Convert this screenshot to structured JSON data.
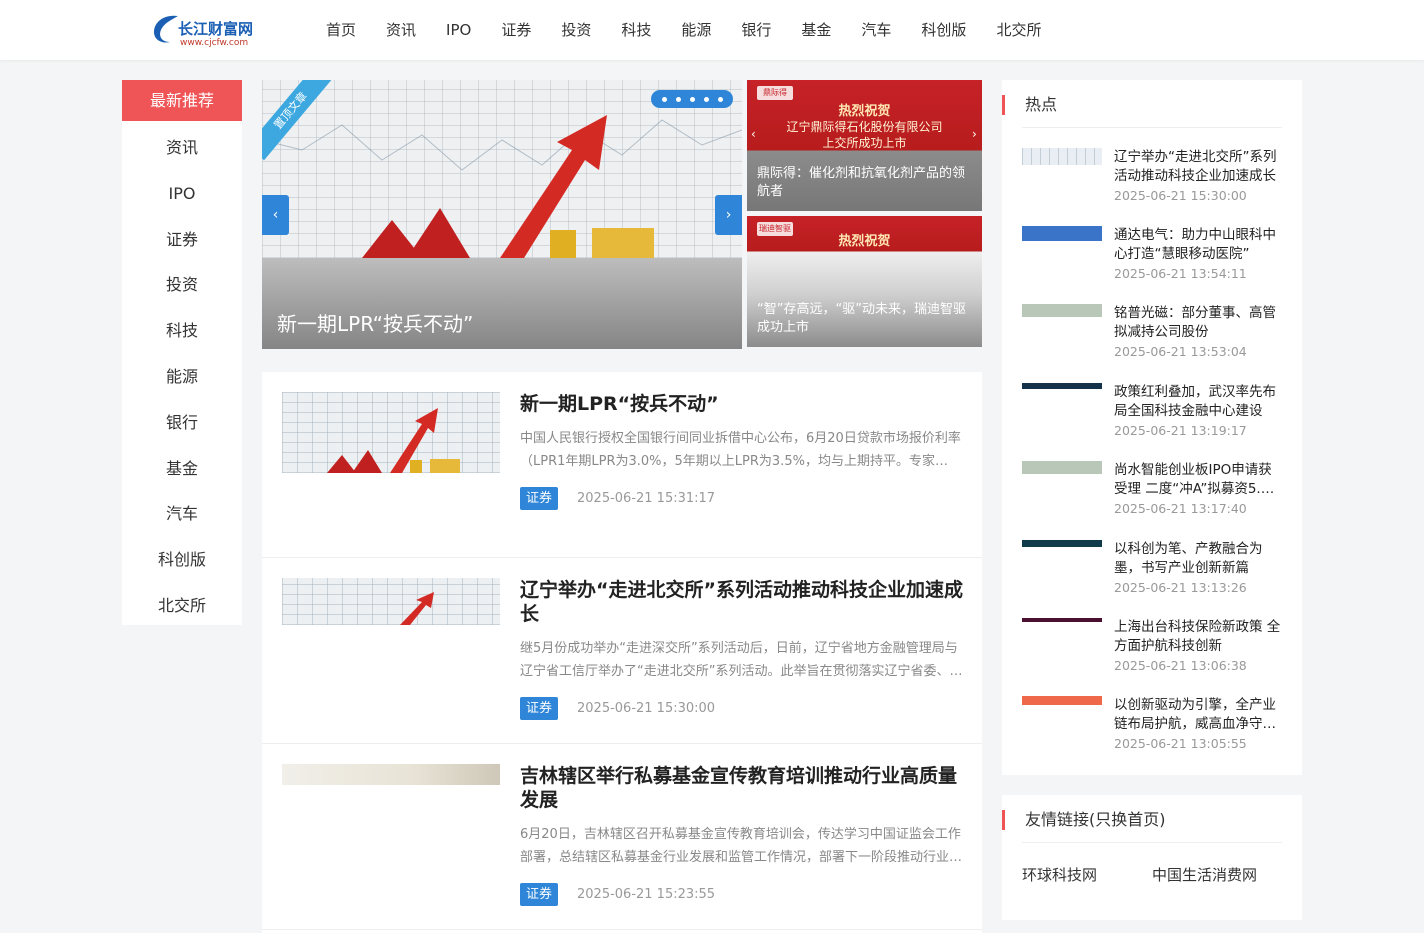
{
  "header": {
    "logo_name": "长江财富网",
    "logo_url": "www.cjcfw.com",
    "nav": [
      "首页",
      "资讯",
      "IPO",
      "证券",
      "投资",
      "科技",
      "能源",
      "银行",
      "基金",
      "汽车",
      "科创版",
      "北交所"
    ]
  },
  "sidebar": {
    "items": [
      "最新推荐",
      "资讯",
      "IPO",
      "证券",
      "投资",
      "科技",
      "能源",
      "银行",
      "基金",
      "汽车",
      "科创版",
      "北交所"
    ],
    "active_index": 0
  },
  "banner": {
    "ribbon": "置顶文章",
    "title": "新一期LPR“按兵不动”",
    "prev_icon": "‹",
    "next_icon": "›"
  },
  "side_banners": [
    {
      "brand": "鼎际得",
      "headline": "热烈祝贺",
      "sub1": "辽宁鼎际得石化股份有限公司",
      "sub2": "上交所成功上市",
      "caption": "鼎际得：催化剂和抗氧化剂产品的领航者"
    },
    {
      "brand": "瑞迪智驱",
      "headline": "热烈祝贺",
      "caption": "“智”存高远，“驱”动未来，瑞迪智驱成功上市"
    }
  ],
  "articles": [
    {
      "title": "新一期LPR“按兵不动”",
      "desc": "中国人民银行授权全国银行间同业拆借中心公布，6月20日贷款市场报价利率（LPR1年期LPR为3.0%，5年期以上LPR为3.5%，均与上期持平。专家…",
      "tag": "证券",
      "time": "2025-06-21 15:31:17"
    },
    {
      "title": "辽宁举办“走进北交所”系列活动推动科技企业加速成长",
      "desc": "继5月份成功举办“走进深交所”系列活动后，日前，辽宁省地方金融管理局与辽宁省工信厅举办了“走进北交所”系列活动。此举旨在贯彻落实辽宁省委、…",
      "tag": "证券",
      "time": "2025-06-21 15:30:00"
    },
    {
      "title": "吉林辖区举行私募基金宣传教育培训推动行业高质量发展",
      "desc": "6月20日，吉林辖区召开私募基金宣传教育培训会，传达学习中国证监会工作部署，总结辖区私募基金行业发展和监管工作情况，部署下一阶段推动行业…",
      "tag": "证券",
      "time": "2025-06-21 15:23:55"
    }
  ],
  "hot": {
    "title": "热点",
    "items": [
      {
        "title": "辽宁举办“走进北交所”系列活动推动科技企业加速成长",
        "time": "2025-06-21 15:30:00"
      },
      {
        "title": "通达电气：助力中山眼科中心打造“慧眼移动医院”",
        "time": "2025-06-21 13:54:11"
      },
      {
        "title": "铭普光磁：部分董事、高管拟减持公司股份",
        "time": "2025-06-21 13:53:04"
      },
      {
        "title": " 政策红利叠加，武汉率先布局全国科技金融中心建设",
        "time": "2025-06-21 13:19:17"
      },
      {
        "title": "尚水智能创业板IPO申请获受理 二度“冲A”拟募资5.…",
        "time": "2025-06-21 13:17:40"
      },
      {
        "title": " 以科创为笔、产教融合为墨，书写产业创新新篇",
        "time": "2025-06-21 13:13:26"
      },
      {
        "title": "上海出台科技保险新政策 全方面护航科技创新",
        "time": "2025-06-21 13:06:38"
      },
      {
        "title": "以创新驱动为引擎，全产业链布局护航，威高血净守…",
        "time": "2025-06-21 13:05:55"
      }
    ]
  },
  "links": {
    "title": "友情链接(只换首页)",
    "items": [
      "环球科技网",
      "中国生活消费网"
    ]
  },
  "colors": {
    "accent_red": "#ef5456",
    "accent_blue": "#2f86d8",
    "banner_red": "#c62228"
  }
}
